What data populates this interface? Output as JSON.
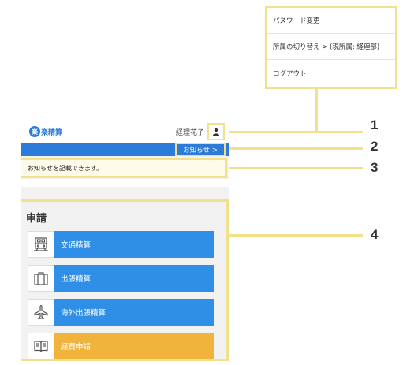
{
  "dropdown": {
    "items": [
      {
        "label": "パスワード変更"
      },
      {
        "label": "所属の切り替え >  (現所属: 経理部)"
      },
      {
        "label": "ログアウト"
      }
    ]
  },
  "header": {
    "logo_mark": "楽",
    "logo_text": "楽精算",
    "user_name": "経理花子",
    "user_icon": "user-icon"
  },
  "bluebar": {
    "notice_link": "お知らせ  >"
  },
  "notice": {
    "text": "お知らせを記載できます。"
  },
  "apply": {
    "title": "申請",
    "items": [
      {
        "label": "交通精算",
        "icon": "train-icon"
      },
      {
        "label": "出張精算",
        "icon": "suitcase-icon"
      },
      {
        "label": "海外出張精算",
        "icon": "airplane-icon"
      },
      {
        "label": "経費申請",
        "icon": "book-icon"
      }
    ]
  },
  "callouts": [
    "1",
    "2",
    "3",
    "4"
  ],
  "colors": {
    "brand_blue": "#2c7bd8",
    "button_blue": "#2f8fe6",
    "button_orange": "#f0b43c",
    "highlight": "#f2e08c"
  }
}
